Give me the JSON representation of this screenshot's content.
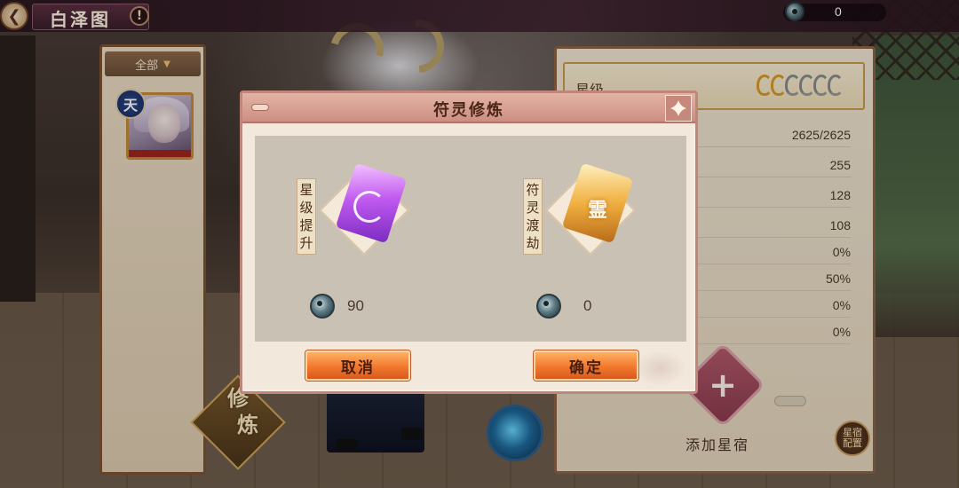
{
  "header": {
    "back_icon": "back-arrow-icon",
    "title": "白泽图",
    "help_label": "!",
    "currency_icon": "coin-icon",
    "currency_value": "0"
  },
  "left_panel": {
    "filter_label": "全部",
    "filter_icon": "triangle-down-icon",
    "rank_badge": "天"
  },
  "stats_panel": {
    "star_label": "星级",
    "star_rating": {
      "filled": 2,
      "total": 6
    },
    "values": [
      "2625/2625",
      "255",
      "128",
      "108",
      "0%",
      "50%",
      "0%",
      "0%"
    ],
    "add_star_label": "添加星宿",
    "add_icon": "plus-icon",
    "star_config_label": "星宿配置"
  },
  "bottom": {
    "cultivate_label": "修炼",
    "skill_icon": "gourd-orb-icon"
  },
  "modal": {
    "title": "符灵修炼",
    "close_icon": "close-icon",
    "options": [
      {
        "label": "星级提升",
        "icon": "purple-rune-scroll-icon",
        "cost_icon": "coin-icon",
        "cost": "90"
      },
      {
        "label": "符灵渡劫",
        "icon": "gold-rune-scroll-icon",
        "glyph": "霊",
        "cost_icon": "coin-icon",
        "cost": "0"
      }
    ],
    "cancel_label": "取消",
    "confirm_label": "确定"
  },
  "colors": {
    "modal_header": "#cc8e82",
    "button_orange": "#f2782e",
    "panel_border": "#8a6242",
    "star_gold": "#d79a2a"
  }
}
